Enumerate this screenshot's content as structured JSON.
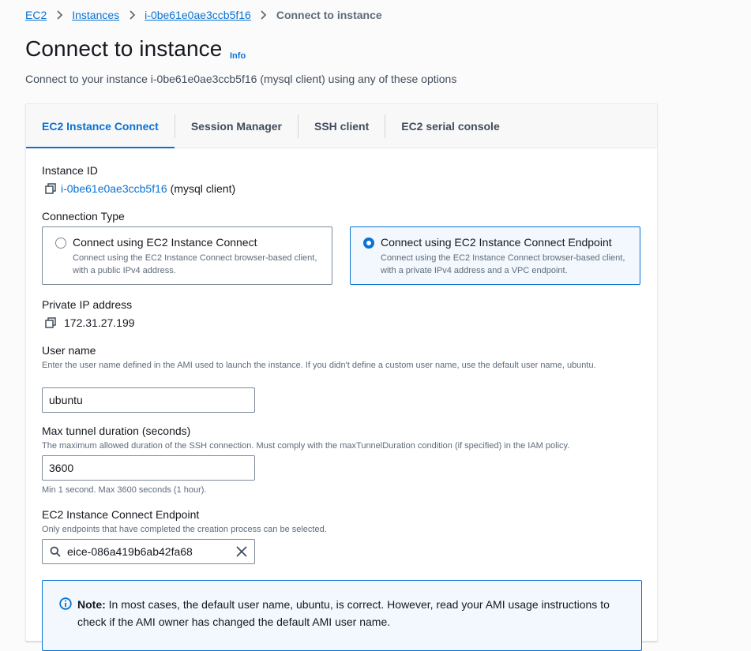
{
  "breadcrumb": {
    "items": [
      "EC2",
      "Instances",
      "i-0be61e0ae3ccb5f16"
    ],
    "current": "Connect to instance"
  },
  "page": {
    "title": "Connect to instance",
    "info_label": "Info",
    "subtitle": "Connect to your instance i-0be61e0ae3ccb5f16 (mysql client) using any of these options"
  },
  "tabs": [
    {
      "label": "EC2 Instance Connect",
      "active": true
    },
    {
      "label": "Session Manager",
      "active": false
    },
    {
      "label": "SSH client",
      "active": false
    },
    {
      "label": "EC2 serial console",
      "active": false
    }
  ],
  "instance": {
    "label": "Instance ID",
    "id": "i-0be61e0ae3ccb5f16",
    "name_suffix": "(mysql client)"
  },
  "connection_type": {
    "label": "Connection Type",
    "options": [
      {
        "title": "Connect using EC2 Instance Connect",
        "desc": "Connect using the EC2 Instance Connect browser-based client, with a public IPv4 address.",
        "selected": false
      },
      {
        "title": "Connect using EC2 Instance Connect Endpoint",
        "desc": "Connect using the EC2 Instance Connect browser-based client, with a private IPv4 address and a VPC endpoint.",
        "selected": true
      }
    ]
  },
  "private_ip": {
    "label": "Private IP address",
    "value": "172.31.27.199"
  },
  "user_name": {
    "label": "User name",
    "desc": "Enter the user name defined in the AMI used to launch the instance. If you didn't define a custom user name, use the default user name, ubuntu.",
    "value": "ubuntu"
  },
  "tunnel": {
    "label": "Max tunnel duration (seconds)",
    "desc": "The maximum allowed duration of the SSH connection. Must comply with the maxTunnelDuration condition (if specified) in the IAM policy.",
    "value": "3600",
    "hint": "Min 1 second. Max 3600 seconds (1 hour)."
  },
  "endpoint": {
    "label": "EC2 Instance Connect Endpoint",
    "desc": "Only endpoints that have completed the creation process can be selected.",
    "value": "eice-086a419b6ab42fa68"
  },
  "note": {
    "prefix": "Note:",
    "text": " In most cases, the default user name, ubuntu, is correct. However, read your AMI usage instructions to check if the AMI owner has changed the default AMI user name."
  },
  "colors": {
    "accent": "#0972d3",
    "text": "#16191f",
    "muted": "#5f6b7a"
  }
}
